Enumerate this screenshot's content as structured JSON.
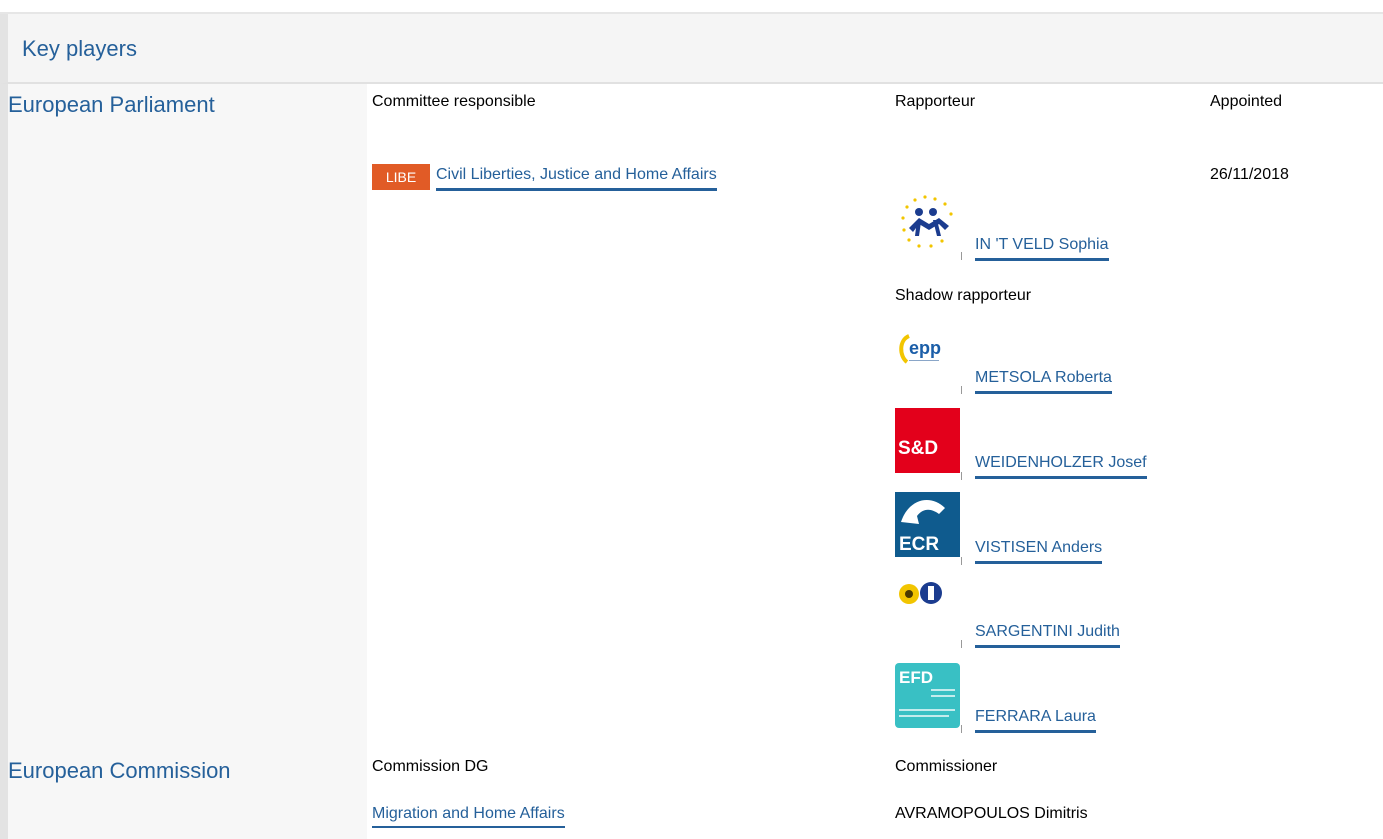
{
  "header": {
    "title": "Key players"
  },
  "ep": {
    "org": "European Parliament",
    "committee_label": "Committee responsible",
    "rapporteur_label": "Rapporteur",
    "appointed_label": "Appointed",
    "committee_code": "LIBE",
    "committee_name": "Civil Liberties, Justice and Home Affairs",
    "appointed_date": "26/11/2018",
    "rapporteur": {
      "name": "IN 'T VELD Sophia",
      "group": "alde-logo-icon"
    },
    "shadow_label": "Shadow rapporteur",
    "shadows": [
      {
        "name": "METSOLA Roberta",
        "group": "epp-logo-icon"
      },
      {
        "name": "WEIDENHOLZER Josef",
        "group": "sd-logo-icon"
      },
      {
        "name": "VISTISEN Anders",
        "group": "ecr-logo-icon"
      },
      {
        "name": "SARGENTINI Judith",
        "group": "greens-efa-logo-icon"
      },
      {
        "name": "FERRARA Laura",
        "group": "efdd-logo-icon"
      }
    ],
    "logo_text": {
      "epp": "epp",
      "sd": "S&D",
      "ecr": "ECR",
      "efd": "EFD"
    }
  },
  "ec": {
    "org": "European Commission",
    "dg_label": "Commission DG",
    "commissioner_label": "Commissioner",
    "dg_name": "Migration and Home Affairs",
    "commissioner_name": "AVRAMOPOULOS Dimitris"
  },
  "colors": {
    "link": "#25609a",
    "badge": "#e15b26",
    "sd": "#e3001b",
    "ecr": "#0f5b8e",
    "efdd": "#39c0c4"
  }
}
